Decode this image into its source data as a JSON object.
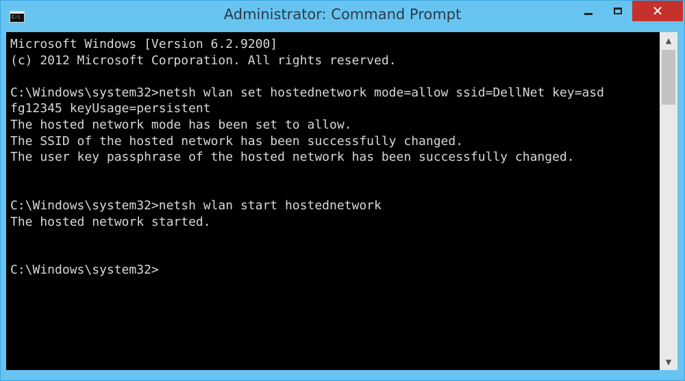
{
  "window": {
    "title": "Administrator: Command Prompt",
    "close_glyph": "✕",
    "icon_prompt": "C:\\"
  },
  "console": {
    "lines": [
      "Microsoft Windows [Version 6.2.9200]",
      "(c) 2012 Microsoft Corporation. All rights reserved.",
      "",
      "C:\\Windows\\system32>netsh wlan set hostednetwork mode=allow ssid=DellNet key=asd",
      "fg12345 keyUsage=persistent",
      "The hosted network mode has been set to allow.",
      "The SSID of the hosted network has been successfully changed.",
      "The user key passphrase of the hosted network has been successfully changed.",
      "",
      "",
      "C:\\Windows\\system32>netsh wlan start hostednetwork",
      "The hosted network started.",
      "",
      "",
      "C:\\Windows\\system32>"
    ]
  },
  "scrollbar": {
    "up_arrow": "▲",
    "down_arrow": "▼"
  },
  "colors": {
    "titlebar": "#67c4f0",
    "close_button": "#c7312c",
    "console_bg": "#000000",
    "console_fg": "#d8d8d8"
  },
  "icons": [
    "cmd-app-icon",
    "minimize-icon",
    "maximize-icon",
    "close-icon",
    "scroll-up-icon",
    "scroll-down-icon"
  ]
}
